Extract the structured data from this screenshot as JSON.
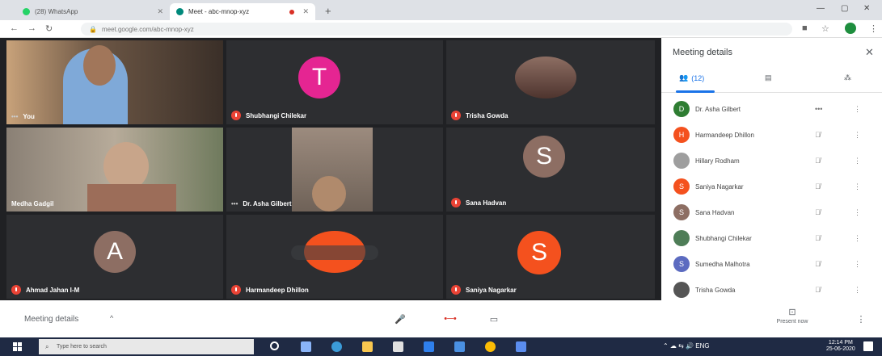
{
  "browser": {
    "tabs": [
      {
        "label": "(28) WhatsApp",
        "favicon_color": "#25d366"
      },
      {
        "label": "Meet - abc-mnop-xyz",
        "favicon_color": "#00897b",
        "recording": true
      }
    ],
    "url": "meet.google.com/abc-mnop-xyz"
  },
  "grid": {
    "tiles": [
      {
        "name": "You",
        "type": "video-boy"
      },
      {
        "name": "Shubhangi Chilekar",
        "type": "avatar",
        "initial": "T",
        "color": "#e52592"
      },
      {
        "name": "Trisha Gowda",
        "type": "photo"
      },
      {
        "name": "Medha Gadgil",
        "type": "video-woman"
      },
      {
        "name": "Dr. Asha Gilbert",
        "type": "video-teacher"
      },
      {
        "name": "Sana Hadvan",
        "type": "avatar",
        "initial": "S",
        "color": "#8d6e63"
      },
      {
        "name": "Ahmad Jahan I-M",
        "type": "avatar",
        "initial": "A",
        "color": "#8d6e63"
      },
      {
        "name": "Harmandeep Dhillon",
        "type": "circle",
        "initial": "",
        "color": "#f4511e"
      },
      {
        "name": "Saniya Nagarkar",
        "type": "avatar",
        "initial": "S",
        "color": "#f4511e"
      }
    ]
  },
  "panel": {
    "title": "Meeting details",
    "tabs": [
      {
        "label": "(12)",
        "icon": "people-icon"
      },
      {
        "label": "",
        "icon": "chat-icon"
      },
      {
        "label": "",
        "icon": "activities-icon"
      }
    ],
    "participants": [
      {
        "name": "Dr. Asha Gilbert",
        "initial": "D",
        "color": "#2e7d32",
        "status": "more"
      },
      {
        "name": "Harmandeep Dhillon",
        "initial": "H",
        "color": "#f4511e",
        "status": "muted"
      },
      {
        "name": "Hillary Rodham",
        "initial": "",
        "color": "#9e9e9e",
        "status": "muted"
      },
      {
        "name": "Saniya Nagarkar",
        "initial": "S",
        "color": "#f4511e",
        "status": "muted"
      },
      {
        "name": "Sana Hadvan",
        "initial": "S",
        "color": "#8d6e63",
        "status": "muted"
      },
      {
        "name": "Shubhangi Chilekar",
        "initial": "",
        "color": "#4e7d57",
        "status": "muted"
      },
      {
        "name": "Sumedha Malhotra",
        "initial": "S",
        "color": "#5c6bc0",
        "status": "muted"
      },
      {
        "name": "Trisha Gowda",
        "initial": "",
        "color": "#555555",
        "status": "muted"
      }
    ]
  },
  "bottombar": {
    "details_label": "Meeting details",
    "present_label": "Present now"
  },
  "taskbar": {
    "search_placeholder": "Type here to search",
    "clock_time": "12:14 PM",
    "clock_date": "25-06-2020"
  }
}
